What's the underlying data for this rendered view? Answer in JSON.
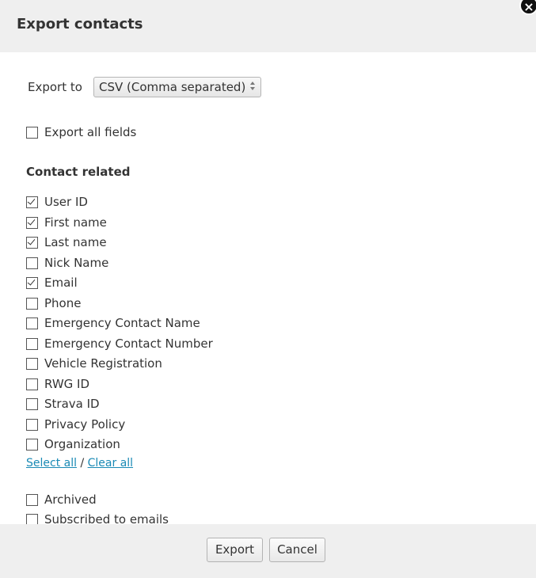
{
  "dialog": {
    "title": "Export contacts",
    "close_glyph": "×"
  },
  "export_to": {
    "label": "Export to",
    "selected": "CSV (Comma separated)"
  },
  "export_all": {
    "label": "Export all fields",
    "checked": false
  },
  "contact_section": {
    "title": "Contact related",
    "fields": [
      {
        "label": "User ID",
        "checked": true
      },
      {
        "label": "First name",
        "checked": true
      },
      {
        "label": "Last name",
        "checked": true
      },
      {
        "label": "Nick Name",
        "checked": false
      },
      {
        "label": "Email",
        "checked": true
      },
      {
        "label": "Phone",
        "checked": false
      },
      {
        "label": "Emergency Contact Name",
        "checked": false
      },
      {
        "label": "Emergency Contact Number",
        "checked": false
      },
      {
        "label": "Vehicle Registration",
        "checked": false
      },
      {
        "label": "RWG ID",
        "checked": false
      },
      {
        "label": "Strava ID",
        "checked": false
      },
      {
        "label": "Privacy Policy",
        "checked": false
      },
      {
        "label": "Organization",
        "checked": false
      }
    ],
    "select_all": "Select all",
    "separator": "/",
    "clear_all": "Clear all"
  },
  "other_fields": [
    {
      "label": "Archived",
      "checked": false
    },
    {
      "label": "Subscribed to emails",
      "checked": false
    }
  ],
  "footer": {
    "export_label": "Export",
    "cancel_label": "Cancel"
  }
}
